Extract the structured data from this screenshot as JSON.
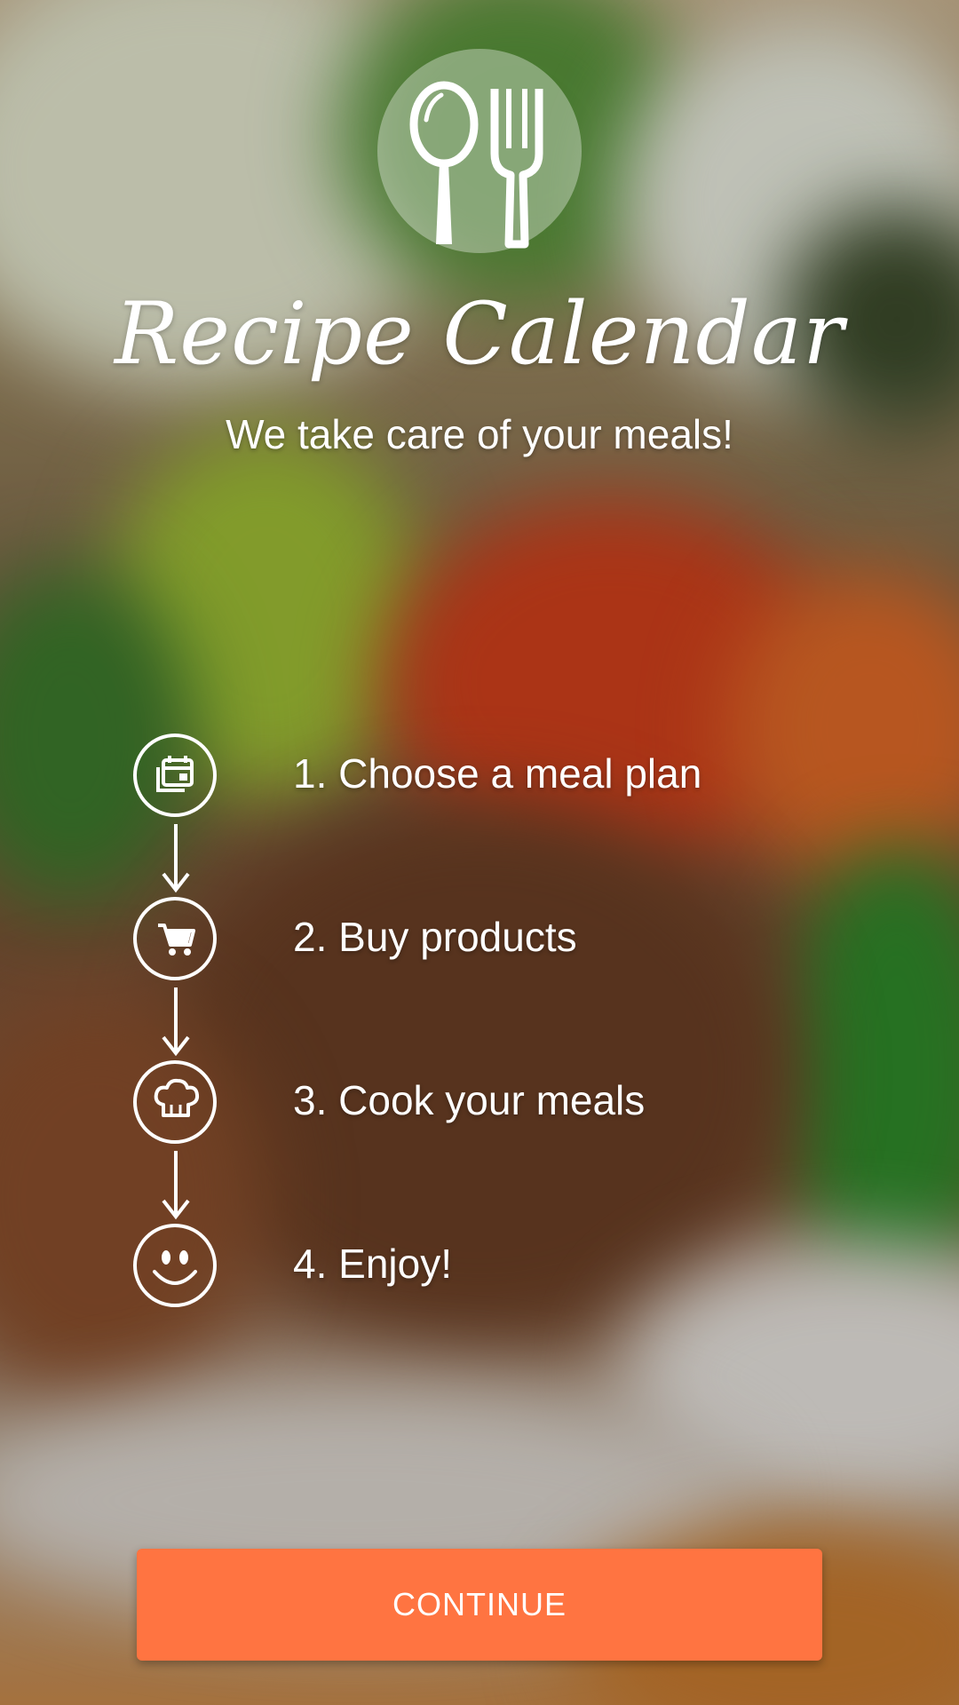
{
  "app": {
    "title": "Recipe Calendar",
    "tagline": "We take care of your meals!",
    "logo_icon": "spoon-fork-icon"
  },
  "steps": [
    {
      "label": "1. Choose a meal plan",
      "icon": "calendar-icon"
    },
    {
      "label": "2. Buy products",
      "icon": "cart-icon"
    },
    {
      "label": "3. Cook your meals",
      "icon": "chef-hat-icon"
    },
    {
      "label": "4. Enjoy!",
      "icon": "smiley-icon"
    }
  ],
  "actions": {
    "continue_label": "CONTINUE"
  },
  "colors": {
    "accent": "#ff7441",
    "text": "#ffffff"
  }
}
